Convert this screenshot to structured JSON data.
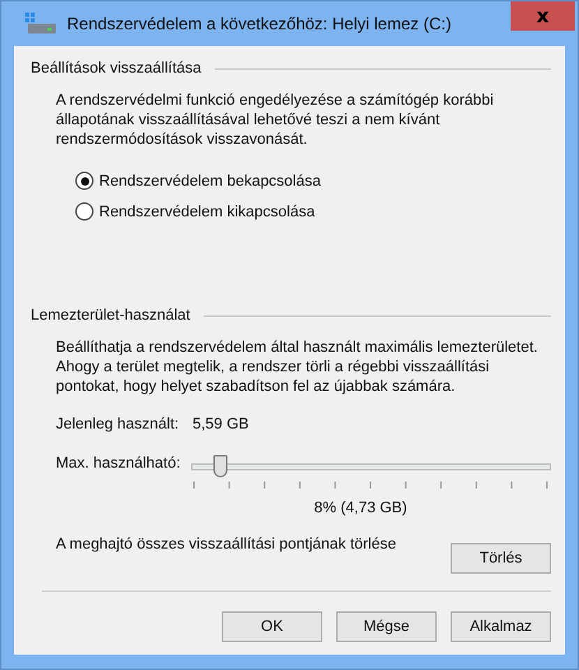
{
  "window": {
    "title": "Rendszervédelem a következőhöz: Helyi lemez (C:)",
    "close": "x"
  },
  "restore_settings": {
    "heading": "Beállítások visszaállítása",
    "description": "A rendszervédelmi funkció engedélyezése a számítógép korábbi állapotának visszaállításával lehetővé teszi a nem kívánt rendszermódosítások visszavonását.",
    "options": [
      {
        "label": "Rendszervédelem bekapcsolása",
        "selected": true
      },
      {
        "label": "Rendszervédelem kikapcsolása",
        "selected": false
      }
    ]
  },
  "disk_usage": {
    "heading": "Lemezterület-használat",
    "description": "Beállíthatja a rendszervédelem által használt maximális lemezterületet. Ahogy a terület megtelik, a rendszer törli a régebbi visszaállítási pontokat, hogy helyet szabadítson fel az újabbak számára.",
    "current_label": "Jelenleg használt:",
    "current_value": "5,59 GB",
    "max_label": "Max. használható:",
    "level": 0.08,
    "reading": "8% (4,73 GB)",
    "delete_text": "A meghajtó összes visszaállítási pontjának törlése",
    "delete_button": "Törlés"
  },
  "buttons": [
    "OK",
    "Mégse",
    "Alkalmaz"
  ]
}
